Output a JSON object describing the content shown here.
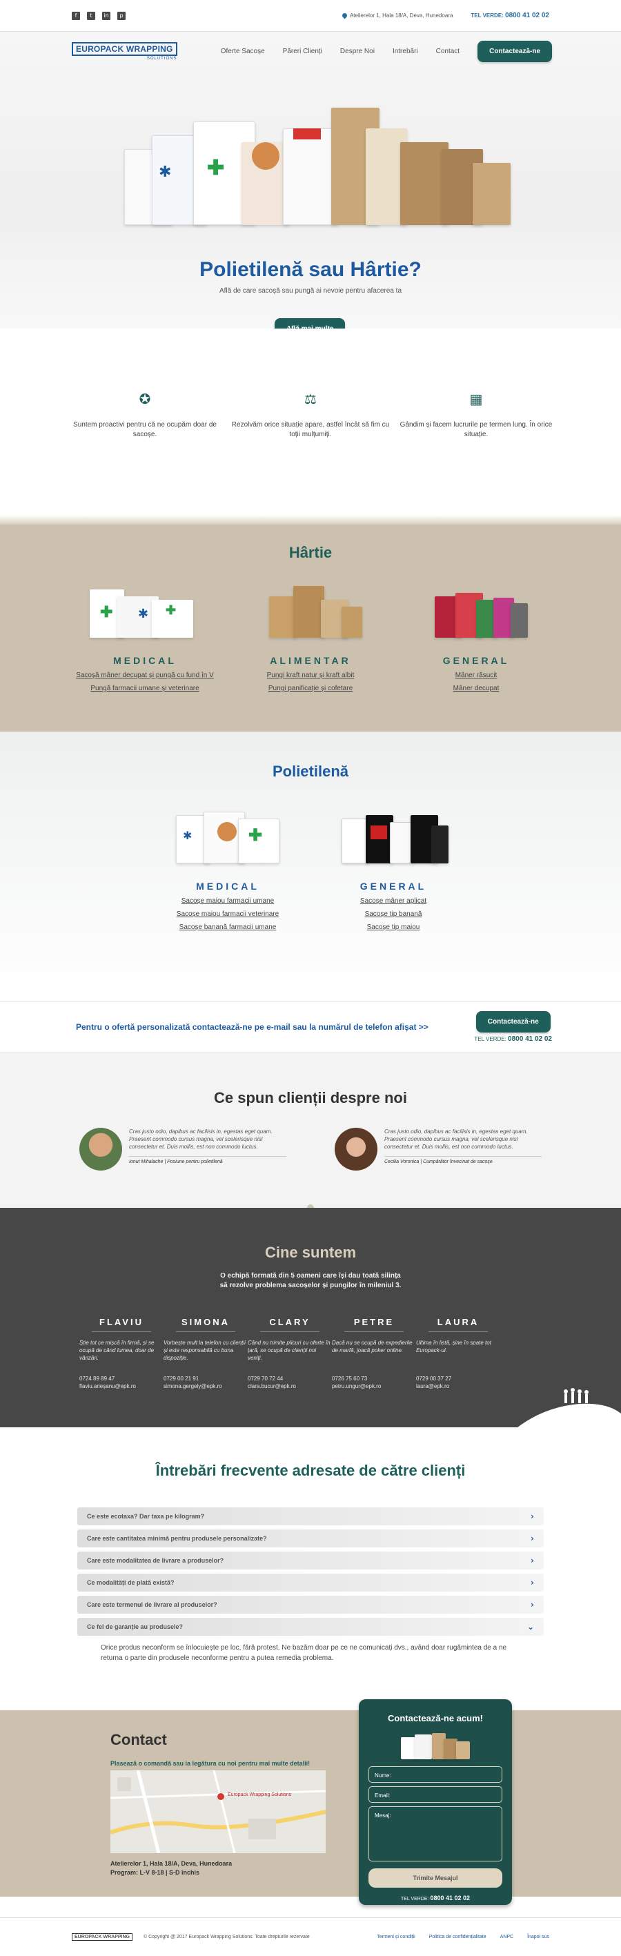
{
  "topbar": {
    "social": [
      {
        "icon": "facebook-icon",
        "glyph": "f"
      },
      {
        "icon": "twitter-icon",
        "glyph": "t"
      },
      {
        "icon": "linkedin-icon",
        "glyph": "in"
      },
      {
        "icon": "pinterest-icon",
        "glyph": "p"
      }
    ],
    "address": "Atelierelor 1, Hala 18/A, Deva, Hunedoara",
    "tel_label": "TEL VERDE:",
    "tel_number": "0800 41 02 02"
  },
  "nav": {
    "logo_title": "EUROPACK WRAPPING",
    "logo_sub": "SOLUTIONS",
    "items": [
      "Oferte Sacoșe",
      "Păreri Clienți",
      "Despre Noi",
      "Intrebări",
      "Contact"
    ],
    "cta": "Contactează-ne"
  },
  "hero": {
    "title": "Polietilenă sau Hârtie?",
    "subtitle": "Află de care sacoșă sau pungă ai nevoie pentru afacerea ta",
    "cta": "Află mai multe"
  },
  "features": [
    {
      "icon": "award-icon",
      "glyph": "✪",
      "text": "Suntem proactivi pentru că ne ocupăm doar de sacoșe."
    },
    {
      "icon": "scales-icon",
      "glyph": "⚖",
      "text": "Rezolvăm orice situație apare, astfel încât să fim cu toții mulțumiți."
    },
    {
      "icon": "calendar-icon",
      "glyph": "▦",
      "text": "Gândim și facem lucrurile pe termen lung. În orice situație."
    }
  ],
  "hartie": {
    "title": "Hârtie",
    "columns": [
      {
        "name": "MEDICAL",
        "links": [
          "Sacoșă mâner decupat și pungă cu fund în V",
          "Pungă farmacii umane și veterinare"
        ]
      },
      {
        "name": "ALIMENTAR",
        "links": [
          "Pungi kraft natur și kraft albit",
          "Pungi panificație și cofetare"
        ]
      },
      {
        "name": "GENERAL",
        "links": [
          "Mâner răsucit",
          "Mâner decupat"
        ]
      }
    ]
  },
  "poli": {
    "title": "Polietilenă",
    "columns": [
      {
        "name": "MEDICAL",
        "links": [
          "Sacoșe maiou farmacii umane",
          "Sacoșe maiou farmacii veterinare",
          "Sacoșe banană farmacii umane"
        ]
      },
      {
        "name": "GENERAL",
        "links": [
          "Sacoșe mâner aplicat",
          "Sacoșe tip banană",
          "Sacoșe tip maiou"
        ]
      }
    ]
  },
  "offer": {
    "text": "Pentru o ofertă personalizată contactează-ne pe e-mail sau la numărul de telefon afișat >>",
    "cta": "Contactează-ne",
    "tel_label": "TEL VERDE:",
    "tel_number": "0800 41 02 02"
  },
  "testimonials": {
    "title": "Ce spun clienții despre noi",
    "items": [
      {
        "quote": "Cras justo odio, dapibus ac facilisis in, egestas eget quam. Praesent commodo cursus magna, vel scelerisque nisl consectetur et. Duis mollis, est non commodo luctus.",
        "author": "Ionut Mihalache | Posiune pentru polietilenă",
        "avatar_color": "#8a6a4a"
      },
      {
        "quote": "Cras justo odio, dapibus ac facilisis in, egestas eget quam. Praesent commodo cursus magna, vel scelerisque nisl consectetur et. Duis mollis, est non commodo luctus.",
        "author": "Cecilia Voronica | Cumpărător învecinat de sacoșe",
        "avatar_color": "#6b4a36"
      }
    ]
  },
  "team": {
    "title": "Cine suntem",
    "intro_line1": "O echipă formată din 5 oameni care își dau toată silința",
    "intro_line2": "să rezolve problema sacoșelor și pungilor în mileniul 3.",
    "members": [
      {
        "name": "FLAVIU",
        "desc": "Știe tot ce mișcă în firmă, și se ocupă de când lumea, doar de vânzări.",
        "phone": "0724 89 89 47",
        "email": "flaviu.arieșanu@epk.ro"
      },
      {
        "name": "SIMONA",
        "desc": "Vorbește mult la telefon cu clienții și este responsabilă cu buna dispoziție.",
        "phone": "0729 00 21 91",
        "email": "simona.gergely@epk.ro"
      },
      {
        "name": "CLARY",
        "desc": "Când nu trimite plicuri cu oferte în țară, se ocupă de clienții noi veniți.",
        "phone": "0729 70 72 44",
        "email": "clara.bucur@epk.ro"
      },
      {
        "name": "PETRE",
        "desc": "Dacă nu se ocupă de expedierile de marfă, joacă poker online.",
        "phone": "0726 75 60 73",
        "email": "petru.ungur@epk.ro"
      },
      {
        "name": "LAURA",
        "desc": "Ultima în listă, șine în spate tot Europack-ul.",
        "phone": "0729 00 37 27",
        "email": "laura@epk.ro"
      }
    ]
  },
  "faq": {
    "title": "Întrebări frecvente adresate de către clienți",
    "items": [
      {
        "q": "Ce este ecotaxa? Dar taxa pe kilogram?",
        "icon": "chevron-right-icon",
        "glyph": "›"
      },
      {
        "q": "Care este cantitatea minimă pentru produsele personalizate?",
        "icon": "chevron-right-icon",
        "glyph": "›"
      },
      {
        "q": "Care este modalitatea de livrare a produselor?",
        "icon": "chevron-right-icon",
        "glyph": "›"
      },
      {
        "q": "Ce modalități de plată există?",
        "icon": "chevron-right-icon",
        "glyph": "›"
      },
      {
        "q": "Care este termenul de livrare al produselor?",
        "icon": "chevron-right-icon",
        "glyph": "›"
      },
      {
        "q": "Ce fel de garanție au produsele?",
        "icon": "chevron-down-icon",
        "glyph": "⌄"
      }
    ],
    "answer": "Orice produs neconform se înlocuiește pe loc, fără protest. Ne bazăm doar pe ce ne comunicați dvs., având doar rugămintea de a ne returna o parte din produsele neconforme pentru a putea remedia problema."
  },
  "contact": {
    "title": "Contact",
    "lead": "Plasează o comandă sau ia legătura cu noi pentru mai multe detalii!",
    "map_label": "Europack Wrapping Solutions",
    "address": "Atelierelor 1, Hala 18/A, Deva, Hunedoara",
    "hours": "Program: L-V 8-18 | S-D închis",
    "form_title": "Contactează-ne acum!",
    "name_label": "Nume:",
    "email_label": "Email:",
    "message_label": "Mesaj:",
    "send": "Trimite Mesajul",
    "tel_label": "TEL VERDE:",
    "tel_number": "0800 41 02 02"
  },
  "footer": {
    "logo": "EUROPACK WRAPPING",
    "copyright": "© Copyright @ 2017 Europack Wrapping Solutions. Toate drepturile rezervate",
    "links": [
      "Termeni și condiții",
      "Politica de confidențialitate",
      "ANPC",
      "Înapoi sus"
    ]
  }
}
